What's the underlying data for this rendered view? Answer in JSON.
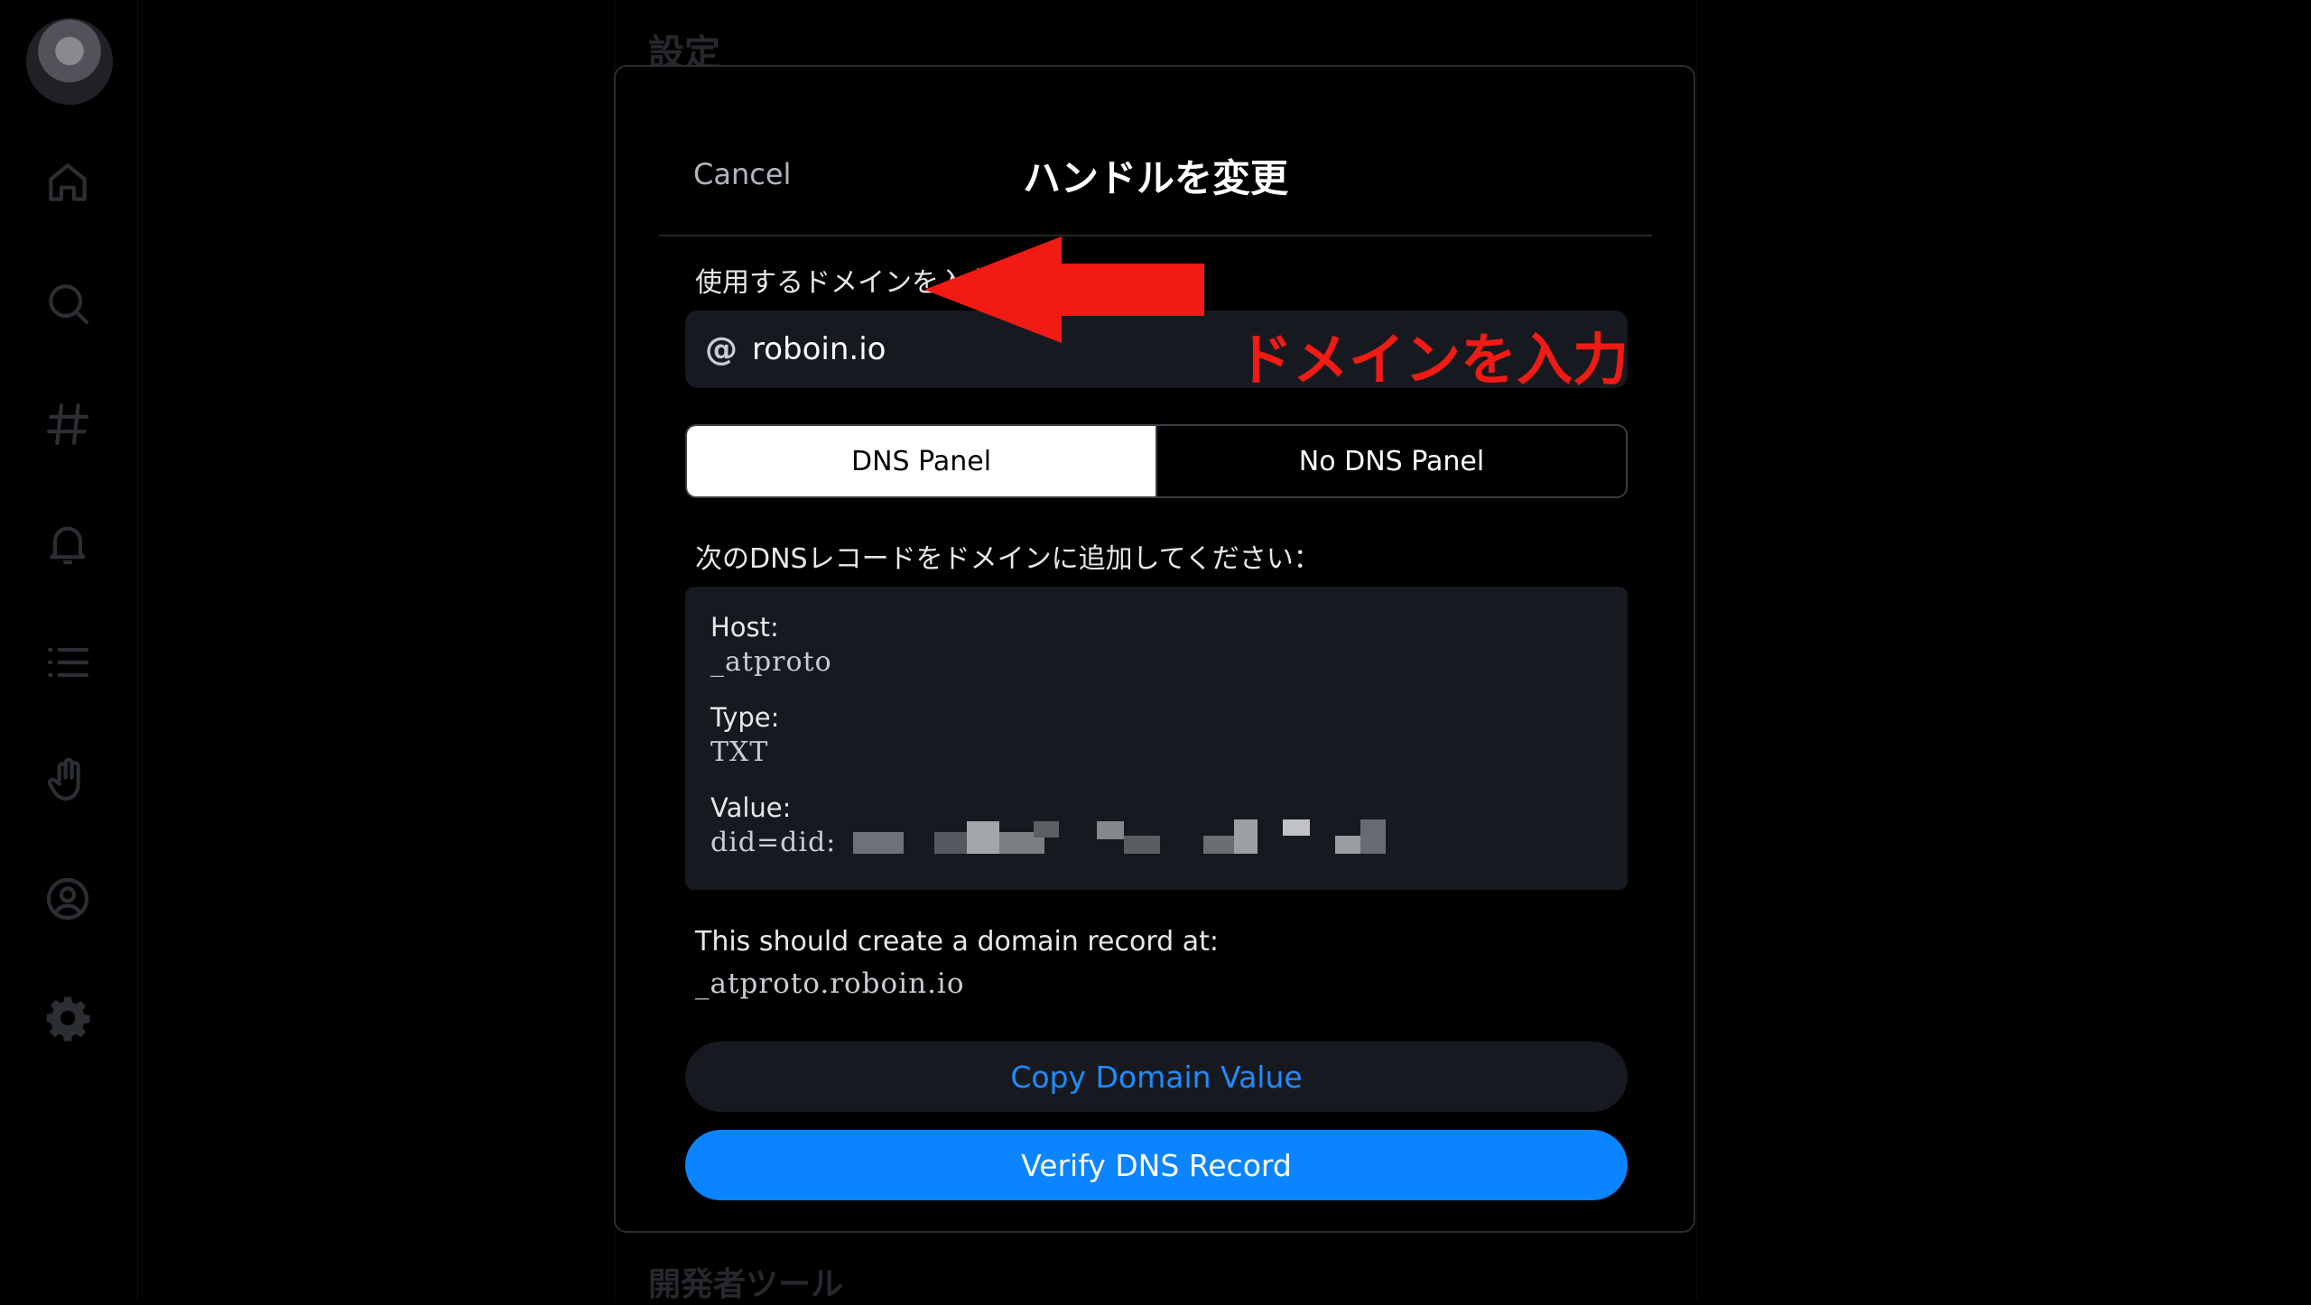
{
  "background": {
    "page_title": "設定",
    "section_devtools": "開発者ツール"
  },
  "sidebar": {
    "icons": [
      "home-icon",
      "search-icon",
      "hashtag-icon",
      "bell-icon",
      "list-icon",
      "hand-icon",
      "profile-icon",
      "gear-icon"
    ]
  },
  "modal": {
    "cancel_label": "Cancel",
    "title": "ハンドルを変更",
    "domain_field_label": "使用するドメインを入力してください",
    "domain_prefix": "@",
    "domain_value": "roboin.io",
    "tabs": [
      {
        "label": "DNS Panel",
        "selected": true
      },
      {
        "label": "No DNS Panel",
        "selected": false
      }
    ],
    "dns_instruction": "次のDNSレコードをドメインに追加してください：",
    "record": {
      "host_label": "Host:",
      "host_value": "_atproto",
      "type_label": "Type:",
      "type_value": "TXT",
      "value_label": "Value:",
      "value_value": "did=did:"
    },
    "record_note_label": "This should create a domain record at:",
    "record_note_domain": "_atproto.roboin.io",
    "copy_button": "Copy Domain Value",
    "verify_button": "Verify DNS Record"
  },
  "annotation": {
    "text": "ドメインを入力",
    "color": "#f21a14"
  },
  "colors": {
    "accent": "#0a84ff",
    "link": "#1f8cff",
    "panel_bg": "#161a20"
  }
}
